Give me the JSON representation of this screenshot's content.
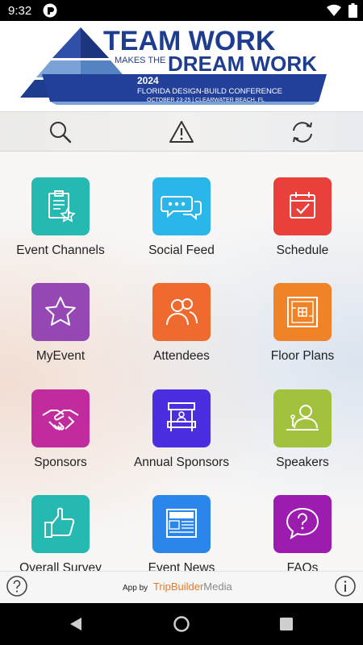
{
  "status_bar": {
    "time": "9:32",
    "icons": [
      "app-icon",
      "wifi-icon",
      "battery-icon"
    ]
  },
  "banner": {
    "line1": "TEAM WORK",
    "line2_small": "MAKES THE",
    "line2": "DREAM WORK",
    "year": "2024",
    "conference": "FLORIDA DESIGN-BUILD CONFERENCE",
    "dates": "OCTOBER 23-25 | CLEARWATER BEACH, FL"
  },
  "toolbar": {
    "buttons": [
      "search-icon",
      "alert-triangle-icon",
      "sync-icon"
    ]
  },
  "tiles": [
    {
      "label": "Event Channels",
      "icon": "clipboard-star-icon",
      "color": "#25b9b2"
    },
    {
      "label": "Social Feed",
      "icon": "chat-bubbles-icon",
      "color": "#2bb6ea"
    },
    {
      "label": "Schedule",
      "icon": "calendar-check-icon",
      "color": "#e9403c"
    },
    {
      "label": "MyEvent",
      "icon": "star-icon",
      "color": "#9548b3"
    },
    {
      "label": "Attendees",
      "icon": "people-icon",
      "color": "#ee6a2e"
    },
    {
      "label": "Floor Plans",
      "icon": "floor-plan-icon",
      "color": "#f08327"
    },
    {
      "label": "Sponsors",
      "icon": "handshake-icon",
      "color": "#c12b9d"
    },
    {
      "label": "Annual Sponsors",
      "icon": "booth-icon",
      "color": "#4a2ee0"
    },
    {
      "label": "Speakers",
      "icon": "speaker-podium-icon",
      "color": "#a2c23d"
    },
    {
      "label": "Overall Survey",
      "icon": "thumbs-up-icon",
      "color": "#25b9b2"
    },
    {
      "label": "Event News",
      "icon": "newspaper-icon",
      "color": "#2b86ec"
    },
    {
      "label": "FAQs",
      "icon": "question-bubble-icon",
      "color": "#9c1cb0"
    }
  ],
  "footer": {
    "credit_prefix": "App by",
    "brand_trip": "Trip",
    "brand_builder": "Builder",
    "brand_media": "Media",
    "help_icon": "help-icon",
    "info_icon": "info-icon"
  },
  "nav_bar": {
    "buttons": [
      "back-icon",
      "home-icon",
      "recents-icon"
    ]
  }
}
